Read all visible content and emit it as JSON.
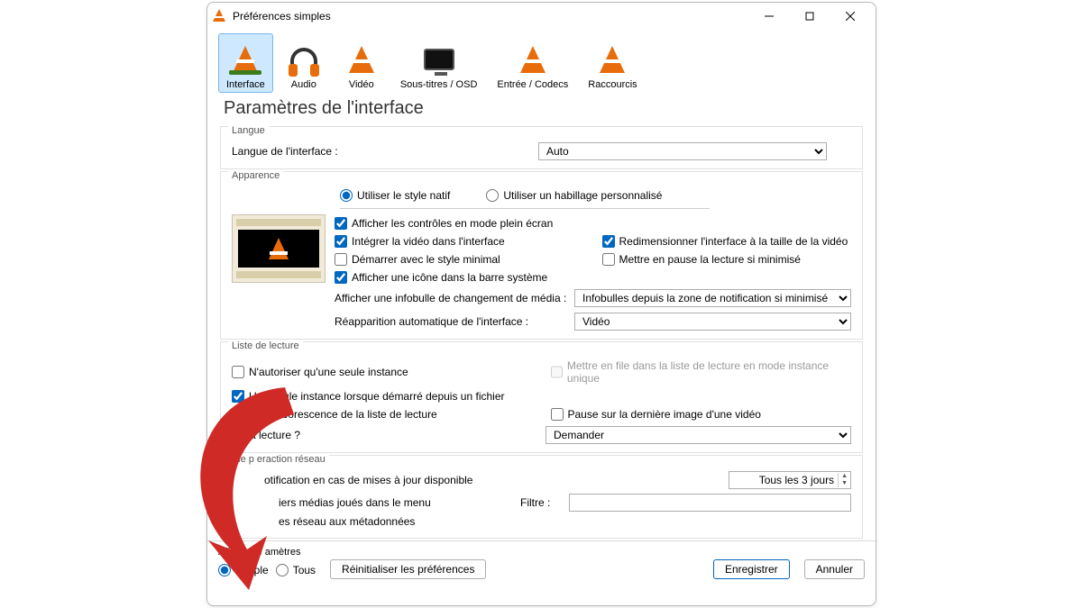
{
  "window": {
    "title": "Préférences simples"
  },
  "tabs": {
    "items": [
      {
        "label": "Interface"
      },
      {
        "label": "Audio"
      },
      {
        "label": "Vidéo"
      },
      {
        "label": "Sous-titres / OSD"
      },
      {
        "label": "Entrée / Codecs"
      },
      {
        "label": "Raccourcis"
      }
    ]
  },
  "heading": "Paramètres de l'interface",
  "langue": {
    "legend": "Langue",
    "label": "Langue de l'interface :",
    "value": "Auto"
  },
  "apparence": {
    "legend": "Apparence",
    "native": "Utiliser le style natif",
    "skin": "Utiliser un habillage personnalisé",
    "fullscreen_controls": "Afficher les contrôles en mode plein écran",
    "embed_video": "Intégrer la vidéo dans l'interface",
    "resize_interface": "Redimensionner l'interface à la taille de la vidéo",
    "start_minimal": "Démarrer avec le style minimal",
    "pause_minimized": "Mettre en pause la lecture si minimisé",
    "systray": "Afficher une icône dans la barre système",
    "tooltip_label": "Afficher une infobulle de changement de média :",
    "tooltip_value": "Infobulles depuis la zone de notification si minimisé",
    "autoraise_label": "Réapparition automatique de l'interface :",
    "autoraise_value": "Vidéo"
  },
  "playlist": {
    "legend": "Liste de lecture",
    "one_instance": "N'autoriser qu'une seule instance",
    "enqueue": "Mettre en file dans la liste de lecture en mode instance unique",
    "one_instance_file": "Une seule instance lorsque démarré depuis un fichier",
    "tree": "ser l'arborescence de la liste de lecture",
    "pause_last_frame": "Pause sur la dernière image d'une vidéo",
    "continue_label": "a lecture ?",
    "continue_value": "Demander"
  },
  "privacy": {
    "legend": "Vie p               eraction réseau",
    "updates": "otification en cas de mises à jour disponible",
    "updates_freq": "Tous les 3 jours",
    "recent": "iers médias joués dans le menu",
    "filter_label": "Filtre :",
    "metadata": "es réseau aux métadonnées"
  },
  "bottom": {
    "show_prefs_label": "Afficher le         amètres",
    "simple": "Simple",
    "all": "Tous",
    "reset": "Réinitialiser les préférences",
    "save": "Enregistrer",
    "cancel": "Annuler"
  }
}
